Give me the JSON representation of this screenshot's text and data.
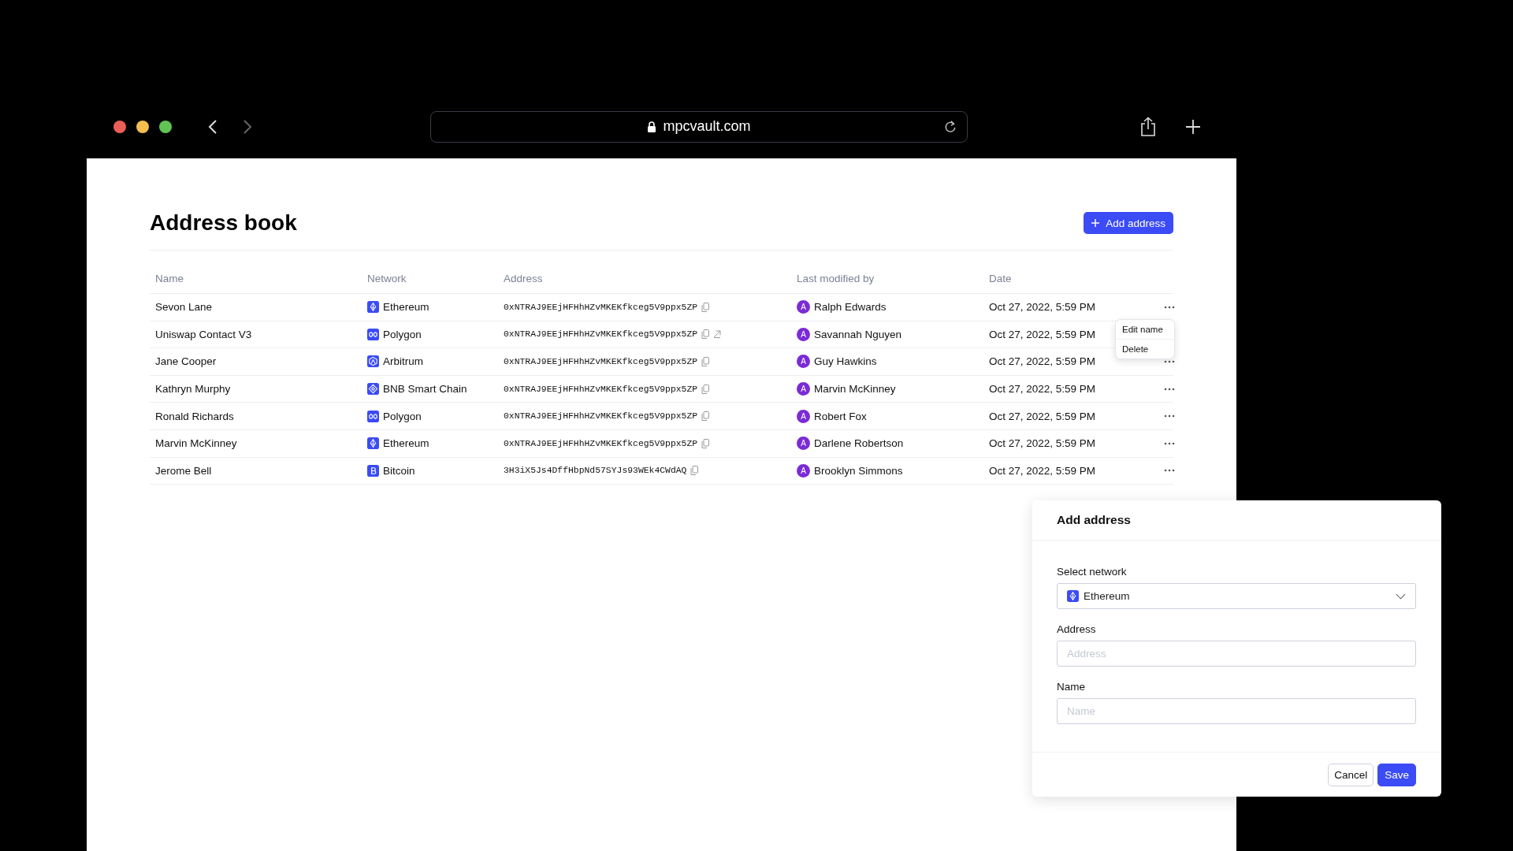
{
  "browser": {
    "url": "mpcvault.com"
  },
  "page": {
    "title": "Address book",
    "add_button": "Add address"
  },
  "table": {
    "columns": [
      "Name",
      "Network",
      "Address",
      "Last modified by",
      "Date"
    ],
    "rows": [
      {
        "name": "Sevon Lane",
        "network": "Ethereum",
        "kind": "ethereum",
        "address": "0xNTRAJ9EEjHFHhHZvMKEKfkceg5V9ppx5ZP",
        "external_link": false,
        "avatar": "A",
        "modified_by": "Ralph Edwards",
        "date": "Oct 27, 2022, 5:59 PM",
        "more_button": true
      },
      {
        "name": "Uniswap Contact V3",
        "network": "Polygon",
        "kind": "polygon",
        "address": "0xNTRAJ9EEjHFHhHZvMKEKfkceg5V9ppx5ZP",
        "external_link": true,
        "avatar": "A",
        "modified_by": "Savannah Nguyen",
        "date": "Oct 27, 2022, 5:59 PM",
        "more_button": false
      },
      {
        "name": "Jane Cooper",
        "network": "Arbitrum",
        "kind": "arbitrum",
        "address": "0xNTRAJ9EEjHFHhHZvMKEKfkceg5V9ppx5ZP",
        "external_link": false,
        "avatar": "A",
        "modified_by": "Guy Hawkins",
        "date": "Oct 27, 2022, 5:59 PM",
        "more_button": true
      },
      {
        "name": "Kathryn Murphy",
        "network": "BNB Smart Chain",
        "kind": "bnb",
        "address": "0xNTRAJ9EEjHFHhHZvMKEKfkceg5V9ppx5ZP",
        "external_link": false,
        "avatar": "A",
        "modified_by": "Marvin McKinney",
        "date": "Oct 27, 2022, 5:59 PM",
        "more_button": true
      },
      {
        "name": "Ronald Richards",
        "network": "Polygon",
        "kind": "polygon",
        "address": "0xNTRAJ9EEjHFHhHZvMKEKfkceg5V9ppx5ZP",
        "external_link": false,
        "avatar": "A",
        "modified_by": "Robert Fox",
        "date": "Oct 27, 2022, 5:59 PM",
        "more_button": true
      },
      {
        "name": "Marvin McKinney",
        "network": "Ethereum",
        "kind": "ethereum",
        "address": "0xNTRAJ9EEjHFHhHZvMKEKfkceg5V9ppx5ZP",
        "external_link": false,
        "avatar": "A",
        "modified_by": "Darlene Robertson",
        "date": "Oct 27, 2022, 5:59 PM",
        "more_button": true
      },
      {
        "name": "Jerome Bell",
        "network": "Bitcoin",
        "kind": "bitcoin",
        "address": "3H3iX5Js4DffHbpNd57SYJs93WEk4CWdAQ",
        "external_link": false,
        "avatar": "A",
        "modified_by": "Brooklyn Simmons",
        "date": "Oct 27, 2022, 5:59 PM",
        "more_button": true
      }
    ]
  },
  "row_menu": {
    "items": [
      "Edit name",
      "Delete"
    ]
  },
  "dialog": {
    "title": "Add address",
    "network_label": "Select network",
    "network_select": {
      "value": "Ethereum",
      "kind": "ethereum"
    },
    "address_label": "Address",
    "address_placeholder": "Address",
    "name_label": "Name",
    "name_placeholder": "Name",
    "cancel": "Cancel",
    "save": "Save"
  }
}
